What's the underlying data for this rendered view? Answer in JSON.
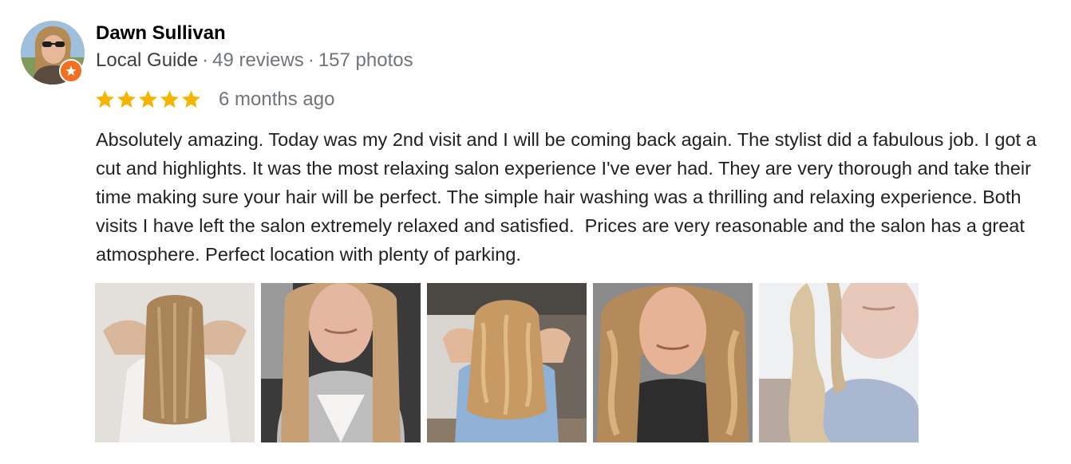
{
  "reviewer": {
    "name": "Dawn Sullivan",
    "badge": "Local Guide",
    "separator": "·",
    "reviews": "49 reviews",
    "photos": "157 photos",
    "avatar_icon": "profile-avatar",
    "badge_icon": "local-guide-star-icon"
  },
  "rating": {
    "stars": 5,
    "max_stars": 5,
    "star_color": "#f4b400",
    "when": "6 months ago"
  },
  "review": {
    "text": "Absolutely amazing. Today was my 2nd visit and I will be coming back again. The stylist did a fabulous job. I got a cut and highlights. It was the most relaxing salon experience I've ever had. They are very thorough and take their time making sure your hair will be perfect. The simple hair washing was a thrilling and relaxing experience. Both visits I have left the salon extremely relaxed and satisfied.  Prices are very reasonable and the salon has a great atmosphere. Perfect location with plenty of parking."
  },
  "colors": {
    "name": "#000000",
    "meta": "#70757a",
    "body": "#202124",
    "guide_badge": "#f26f21"
  }
}
